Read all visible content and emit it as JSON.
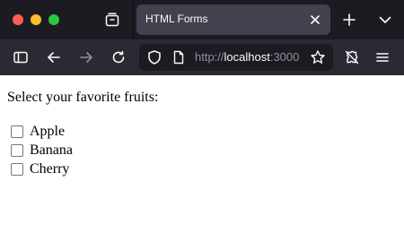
{
  "tab": {
    "title": "HTML Forms"
  },
  "address_bar": {
    "url_scheme": "http://",
    "url_host": "localhost",
    "url_rest": ":3000"
  },
  "page": {
    "prompt": "Select your favorite fruits:",
    "options": [
      {
        "label": "Apple",
        "checked": false
      },
      {
        "label": "Banana",
        "checked": false
      },
      {
        "label": "Cherry",
        "checked": false
      }
    ]
  },
  "colors": {
    "tabbar_bg": "#1c1b22",
    "active_tab_bg": "#42414d",
    "navbar_bg": "#2b2a33",
    "urlbar_bg": "#1c1b22",
    "close_light": "#fe5f57",
    "minimize_light": "#febc2e",
    "maximize_light": "#28c840"
  },
  "icons": {
    "tab_overview": "tab-overview-icon",
    "tab_close": "close-icon",
    "new_tab": "plus-icon",
    "list_tabs": "chevron-down-icon",
    "sidebar": "sidebar-icon",
    "back": "back-arrow-icon",
    "forward": "forward-arrow-icon",
    "reload": "reload-icon",
    "tracking_protection": "shield-icon",
    "page_info": "page-icon",
    "bookmark": "star-icon",
    "extensions": "extensions-icon",
    "menu": "hamburger-menu-icon"
  }
}
